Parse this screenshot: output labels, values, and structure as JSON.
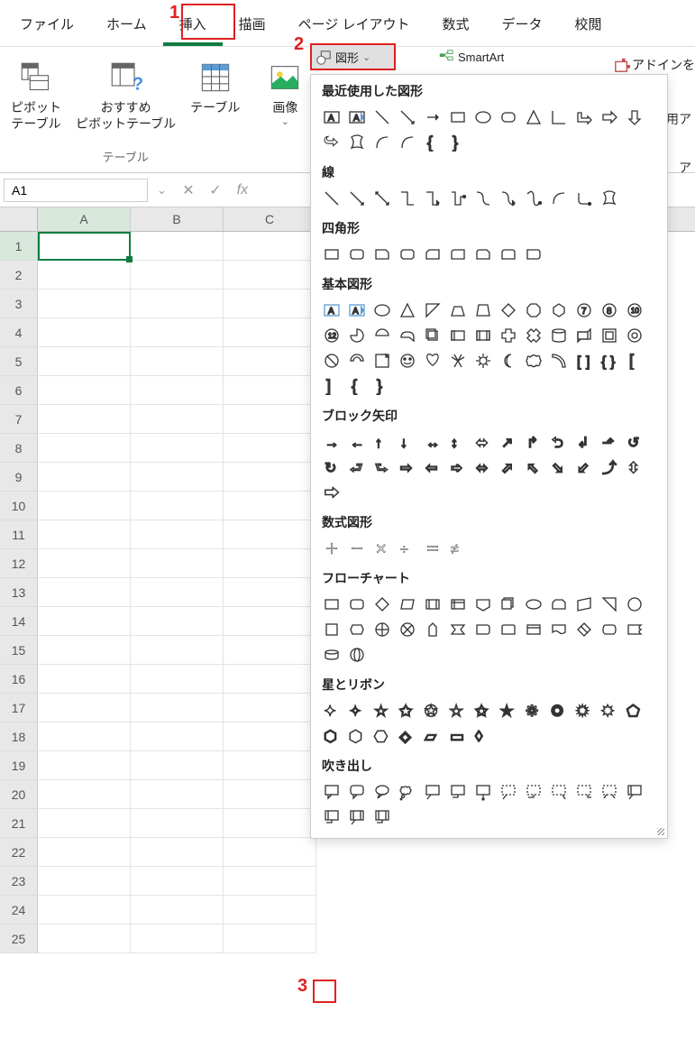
{
  "tabs": {
    "file": "ファイル",
    "home": "ホーム",
    "insert": "挿入",
    "draw": "描画",
    "page_layout": "ページ レイアウト",
    "formulas": "数式",
    "data": "データ",
    "review": "校閲"
  },
  "ribbon": {
    "group_tables": "テーブル",
    "pivot_table": "ピボット\nテーブル",
    "recommended_pivot": "おすすめ\nピボットテーブル",
    "table": "テーブル",
    "images": "画像",
    "shapes": "図形",
    "smartart": "SmartArt",
    "addins": "アドインを",
    "personal": "人用ア",
    "apps": "ア"
  },
  "formula_bar": {
    "name_box": "A1",
    "fx": "fx"
  },
  "columns": [
    "A",
    "B",
    "C"
  ],
  "rows": [
    "1",
    "2",
    "3",
    "4",
    "5",
    "6",
    "7",
    "8",
    "9",
    "10",
    "11",
    "12",
    "13",
    "14",
    "15",
    "16",
    "17",
    "18",
    "19",
    "20",
    "21",
    "22",
    "23",
    "24",
    "25"
  ],
  "shapes_dropdown": {
    "recent": "最近使用した図形",
    "lines": "線",
    "rectangles": "四角形",
    "basic": "基本図形",
    "block_arrows": "ブロック矢印",
    "equation": "数式図形",
    "flowchart": "フローチャート",
    "stars": "星とリボン",
    "callouts": "吹き出し"
  },
  "annotations": {
    "one": "1",
    "two": "2",
    "three": "3"
  }
}
